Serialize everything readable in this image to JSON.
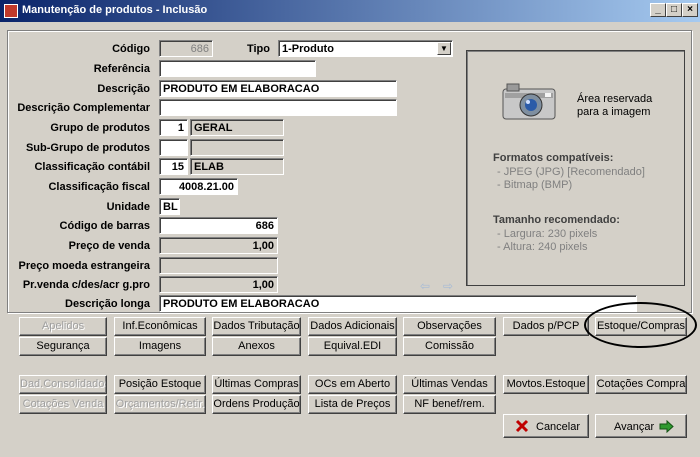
{
  "window": {
    "title": "Manutenção de produtos - Inclusão",
    "minimize": "_",
    "maximize": "□",
    "close": "×"
  },
  "fields": {
    "codigo": {
      "label": "Código",
      "value": "686"
    },
    "tipo": {
      "label": "Tipo",
      "value": "1-Produto"
    },
    "referencia": {
      "label": "Referência",
      "value": ""
    },
    "descricao": {
      "label": "Descrição",
      "value": "PRODUTO EM ELABORACAO"
    },
    "descricao_complementar": {
      "label": "Descrição Complementar",
      "value": ""
    },
    "grupo": {
      "label": "Grupo de produtos",
      "code": "1",
      "name": "GERAL"
    },
    "subgrupo": {
      "label": "Sub-Grupo de produtos",
      "code": "",
      "name": ""
    },
    "classificacao_contabil": {
      "label": "Classificação contábil",
      "code": "15",
      "name": "ELAB"
    },
    "classificacao_fiscal": {
      "label": "Classificação fiscal",
      "value": "4008.21.00"
    },
    "unidade": {
      "label": "Unidade",
      "value": "BL"
    },
    "codigo_barras": {
      "label": "Código de barras",
      "value": "686"
    },
    "preco_venda": {
      "label": "Preço de venda",
      "value": "1,00"
    },
    "preco_moeda_estrangeira": {
      "label": "Preço moeda estrangeira",
      "value": ""
    },
    "pr_venda_cdes": {
      "label": "Pr.venda c/des/acr g.pro",
      "value": "1,00"
    },
    "descricao_longa": {
      "label": "Descrição longa",
      "value": "PRODUTO EM ELABORACAO"
    }
  },
  "image_panel": {
    "reserved_line1": "Área reservada",
    "reserved_line2": "para a imagem",
    "formats_title": "Formatos compatíveis:",
    "format1": "- JPEG (JPG) [Recomendado]",
    "format2": "- Bitmap (BMP)",
    "size_title": "Tamanho recomendado:",
    "size1": "- Largura: 230 pixels",
    "size2": "- Altura: 240 pixels",
    "icon": "camera-icon"
  },
  "tabs_row1": [
    "Apelidos",
    "Inf.Econômicas",
    "Dados Tributação",
    "Dados Adicionais",
    "Observações",
    "Dados p/PCP",
    "Estoque/Compras"
  ],
  "tabs_row2": [
    "Segurança",
    "Imagens",
    "Anexos",
    "Equival.EDI",
    "Comissão"
  ],
  "actions_row1": [
    "Dad.Consolidados",
    "Posição Estoque",
    "Últimas Compras",
    "OCs em Aberto",
    "Últimas Vendas",
    "Movtos.Estoque",
    "Cotações Compra"
  ],
  "actions_row2": [
    "Cotações Venda",
    "Orçamentos/Retir.",
    "Ordens Produção",
    "Lista de Preços",
    "NF benef/rem."
  ],
  "footer": {
    "cancel": "Cancelar",
    "next": "Avançar"
  },
  "colors": {
    "titlebar_start": "#0a246a",
    "titlebar_end": "#a6caf0",
    "face": "#d4d0c8"
  }
}
